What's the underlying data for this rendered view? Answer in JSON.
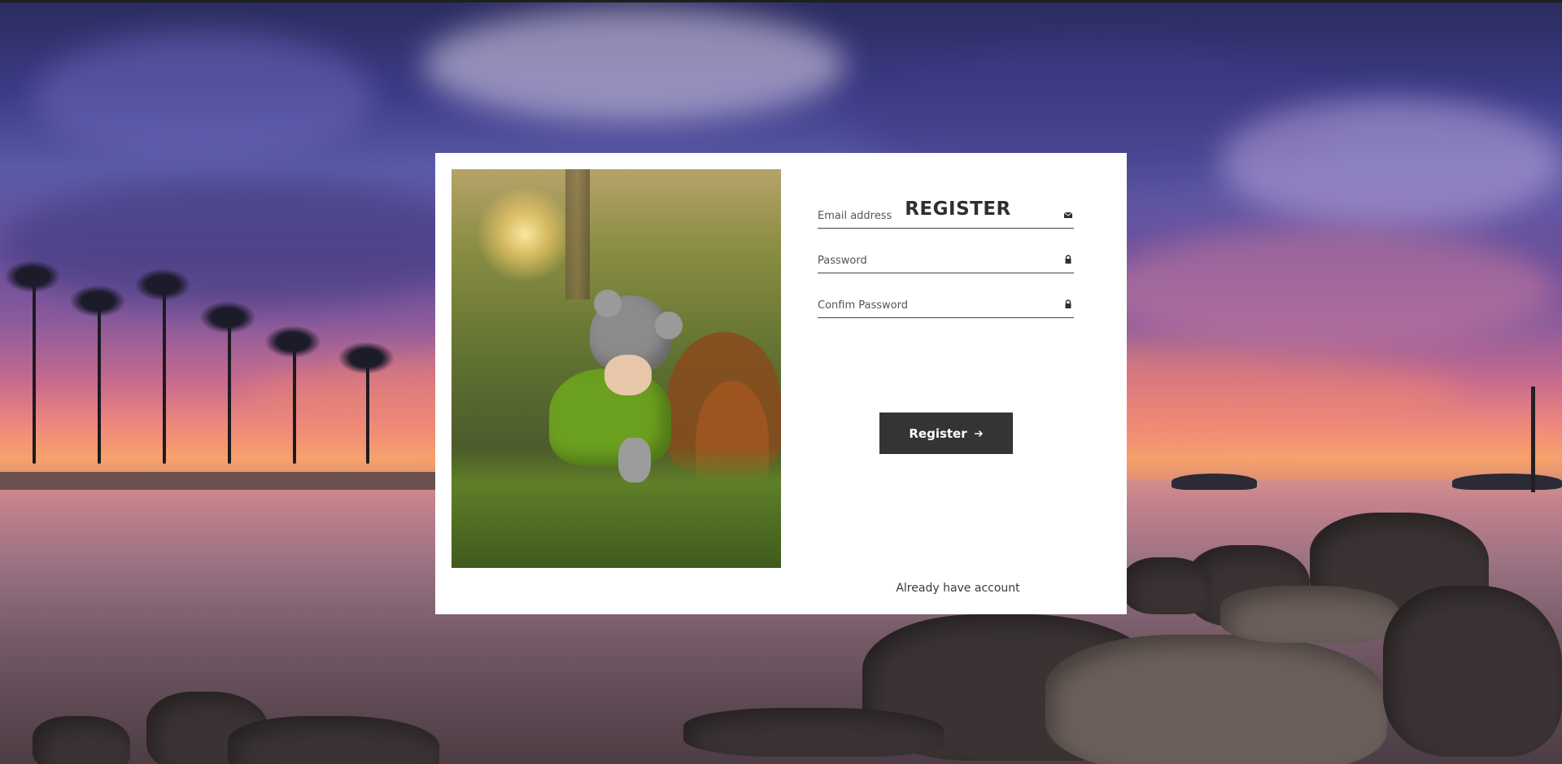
{
  "form": {
    "title": "REGISTER",
    "fields": [
      {
        "placeholder": "Email address",
        "icon": "envelope-icon"
      },
      {
        "placeholder": "Password",
        "icon": "lock-icon"
      },
      {
        "placeholder": "Confim Password",
        "icon": "lock-icon"
      }
    ],
    "submit_label": "Register",
    "submit_icon": "arrow-right-icon",
    "login_link": "Already have account"
  },
  "colors": {
    "button_bg": "#343434",
    "card_bg": "#ffffff",
    "text_dark": "#2f2f2f"
  }
}
